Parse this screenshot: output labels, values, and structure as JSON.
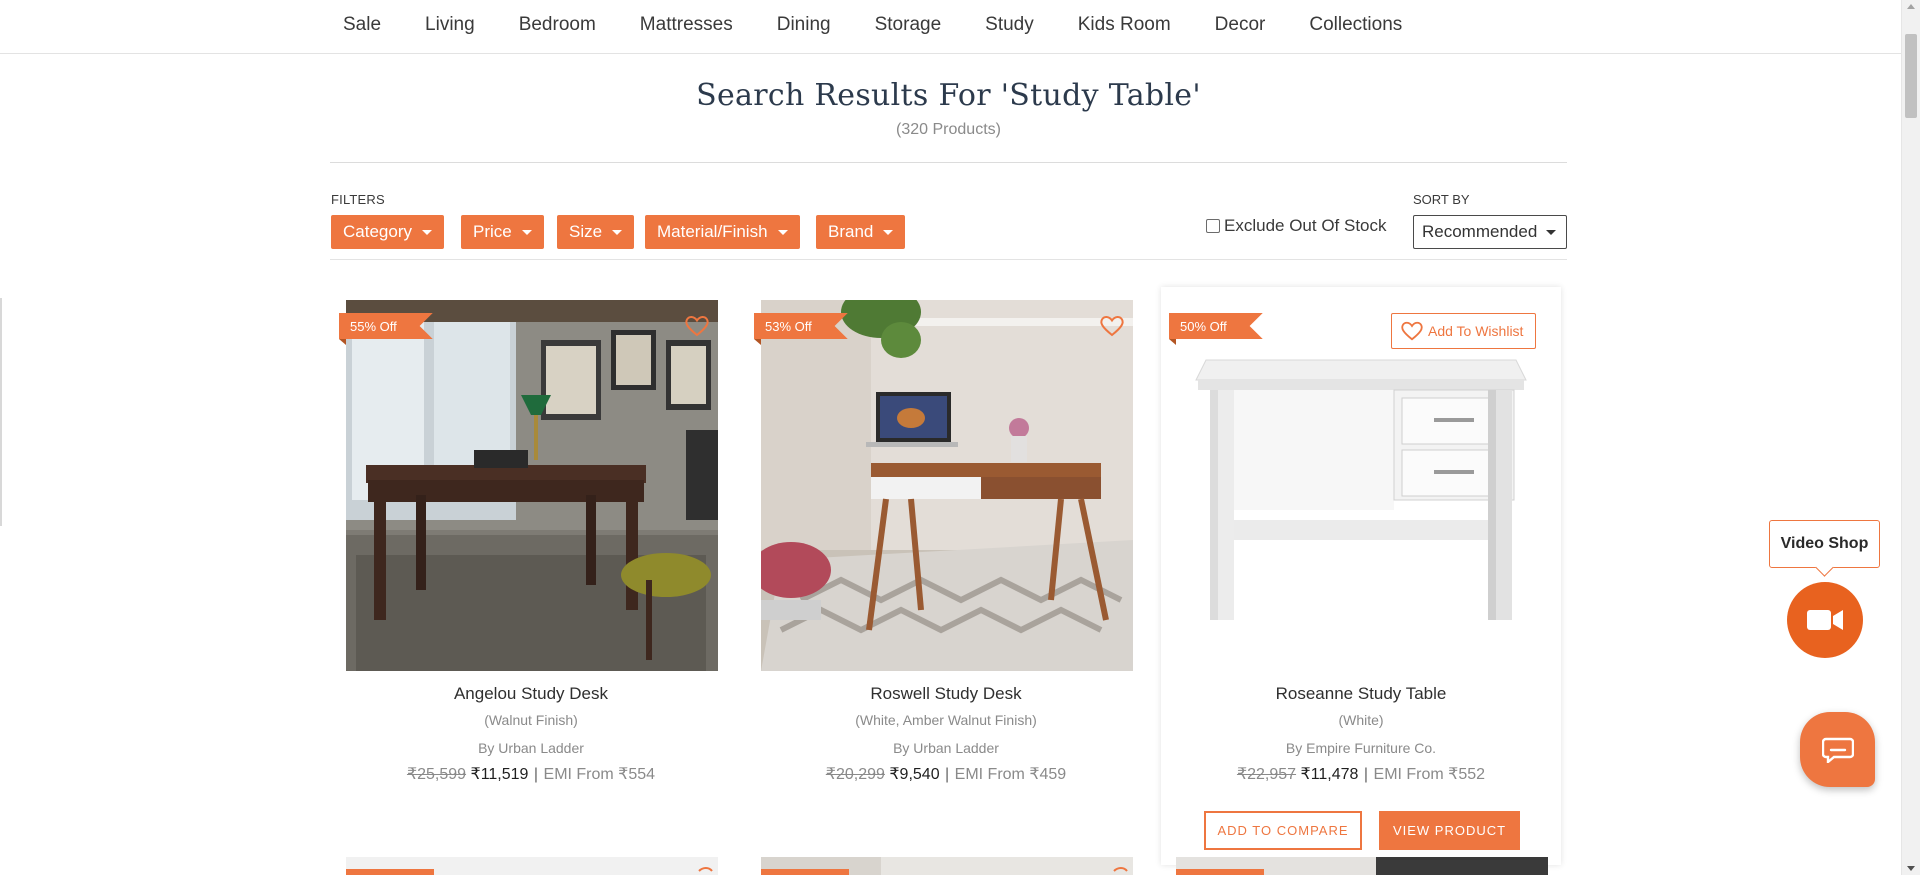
{
  "nav": {
    "items": [
      {
        "label": "Sale"
      },
      {
        "label": "Living"
      },
      {
        "label": "Bedroom"
      },
      {
        "label": "Mattresses"
      },
      {
        "label": "Dining"
      },
      {
        "label": "Storage"
      },
      {
        "label": "Study"
      },
      {
        "label": "Kids Room"
      },
      {
        "label": "Decor"
      },
      {
        "label": "Collections"
      }
    ]
  },
  "search": {
    "title": "Search Results For 'Study Table'",
    "count": "(320 Products)"
  },
  "filters": {
    "label": "FILTERS",
    "buttons": [
      {
        "label": "Category"
      },
      {
        "label": "Price"
      },
      {
        "label": "Size"
      },
      {
        "label": "Material/Finish"
      },
      {
        "label": "Brand"
      }
    ],
    "exclude_label": "Exclude Out Of Stock",
    "exclude_checked": false
  },
  "sort": {
    "label": "SORT BY",
    "value": "Recommended"
  },
  "products": [
    {
      "badge": "55% Off",
      "name": "Angelou Study Desk",
      "variant": "(Walnut Finish)",
      "brand": "By Urban Ladder",
      "mrp": "₹25,599",
      "price": "₹11,519",
      "emi": "EMI From ₹554"
    },
    {
      "badge": "53% Off",
      "name": "Roswell Study Desk",
      "variant": "(White, Amber Walnut Finish)",
      "brand": "By Urban Ladder",
      "mrp": "₹20,299",
      "price": "₹9,540",
      "emi": "EMI From ₹459"
    },
    {
      "badge": "50% Off",
      "name": "Roseanne Study Table",
      "variant": "(White)",
      "brand": "By Empire Furniture Co.",
      "mrp": "₹22,957",
      "price": "₹11,478",
      "emi": "EMI From ₹552",
      "wishlist_label": "Add To Wishlist",
      "compare_label": "ADD TO COMPARE",
      "view_label": "VIEW PRODUCT"
    }
  ],
  "widgets": {
    "video_shop_label": "Video Shop"
  },
  "colors": {
    "accent": "#ee7640",
    "heading": "#2c3a4c"
  }
}
